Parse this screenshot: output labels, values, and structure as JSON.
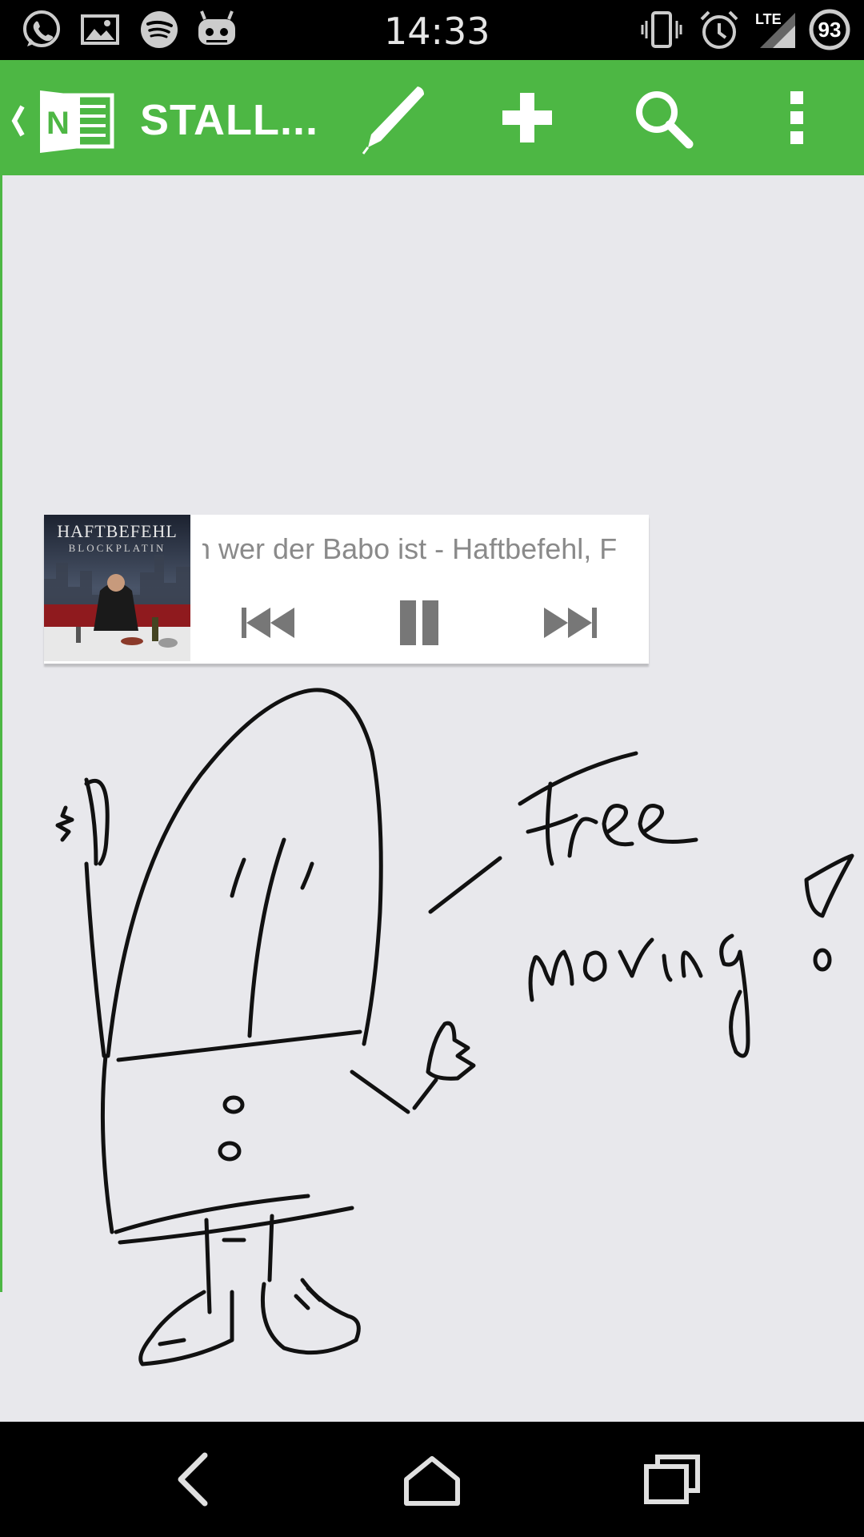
{
  "status_bar": {
    "time": "14:33",
    "network": "LTE",
    "battery_level": "93",
    "left_icons": [
      "whatsapp-icon",
      "gallery-icon",
      "spotify-icon",
      "cyanogen-icon"
    ],
    "right_icons": [
      "vibrate-icon",
      "alarm-icon",
      "lte-signal-icon",
      "battery-icon"
    ]
  },
  "action_bar": {
    "color": "#4db744",
    "app_icon": "onenote-icon",
    "title": "STALL...",
    "actions": [
      "pen-icon",
      "add-icon",
      "search-icon",
      "overflow-menu-icon"
    ]
  },
  "music_widget": {
    "album_title": "HAFTBEFEHL",
    "album_subtitle": "BLOCKPLATIN",
    "track": "n wer der Babo ist - Haftbefehl, F",
    "controls": [
      "previous-icon",
      "pause-icon",
      "next-icon"
    ]
  },
  "drawing": {
    "handwritten_text": [
      "Free",
      "moving!"
    ]
  },
  "nav_bar": {
    "buttons": [
      "back-icon",
      "home-icon",
      "recents-icon"
    ]
  }
}
